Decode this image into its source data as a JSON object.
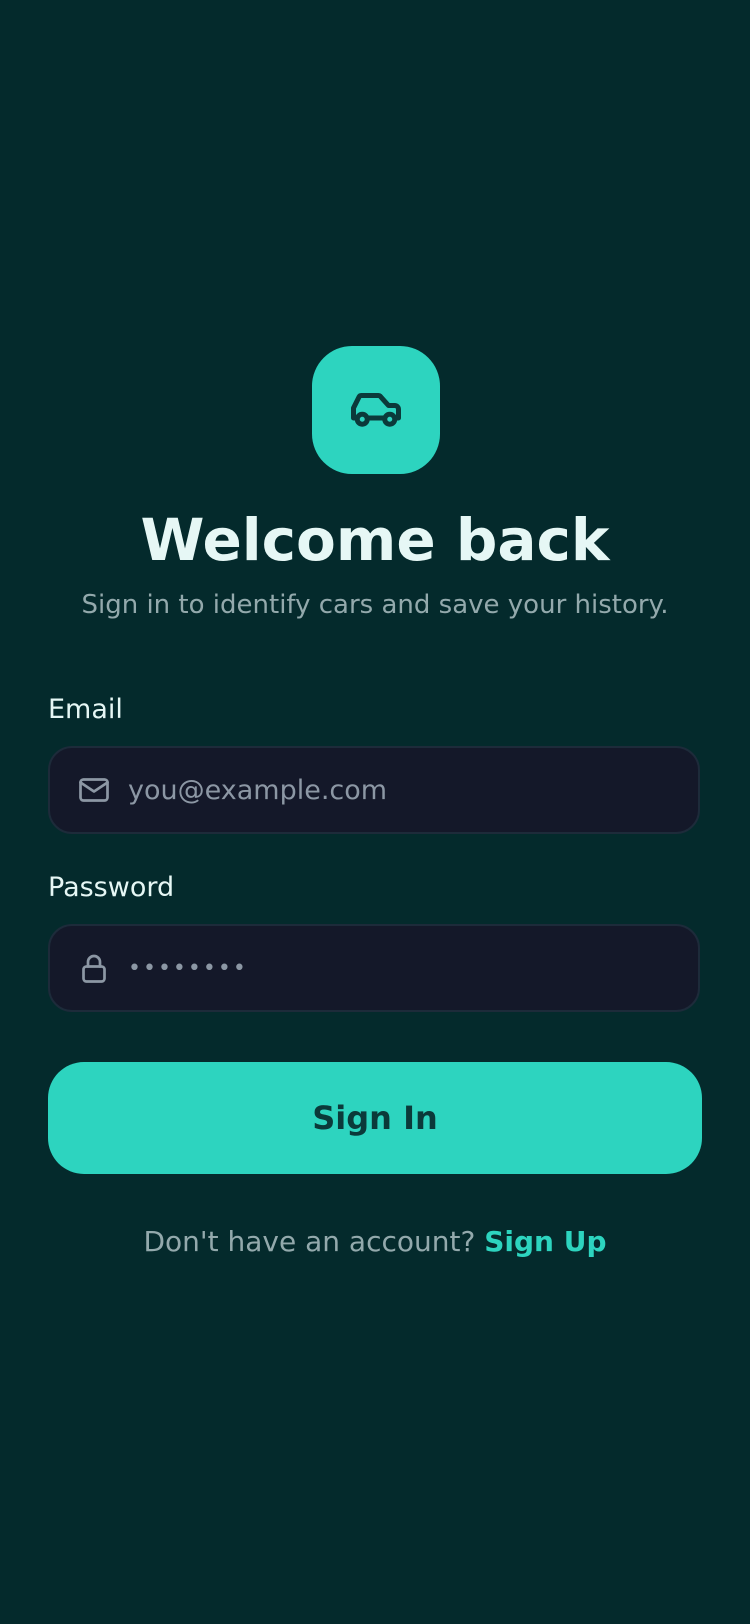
{
  "header": {
    "app_icon": "car-icon",
    "title": "Welcome back",
    "subtitle": "Sign in to identify cars and save your history."
  },
  "form": {
    "email": {
      "label": "Email",
      "placeholder": "you@example.com",
      "value": "",
      "icon": "mail-icon"
    },
    "password": {
      "label": "Password",
      "value": "••••••••",
      "icon": "lock-icon"
    },
    "submit_label": "Sign In"
  },
  "footer": {
    "prompt": "Don't have an account? ",
    "link_label": "Sign Up"
  },
  "colors": {
    "background": "#042a2c",
    "accent": "#2dd4bf",
    "input_bg": "#141829",
    "text_primary": "#e6f7f5",
    "text_muted": "#93a9ac"
  }
}
